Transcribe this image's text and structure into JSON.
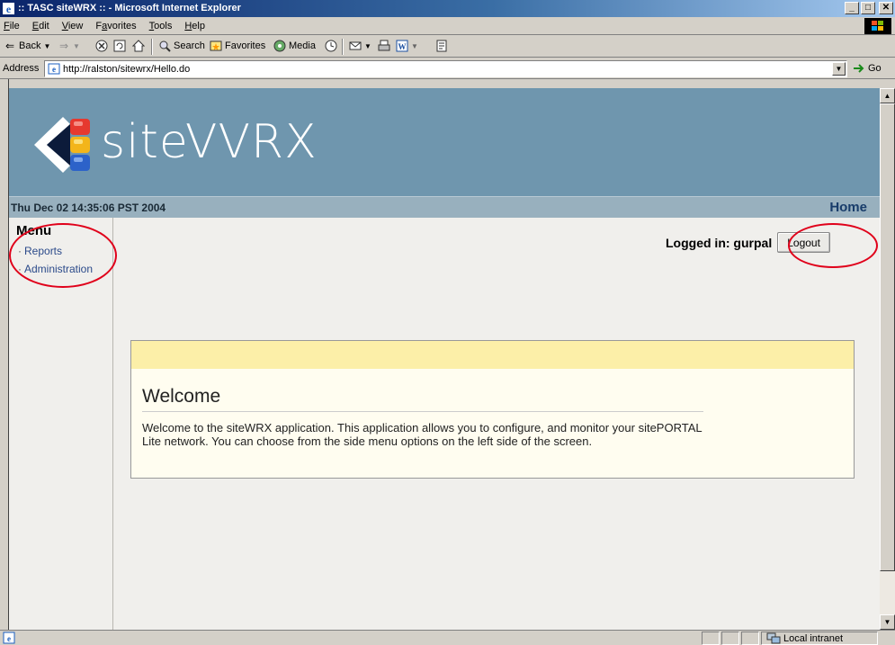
{
  "window": {
    "title": ":: TASC siteWRX :: - Microsoft Internet Explorer",
    "minimize": "_",
    "maximize": "□",
    "close": "✕"
  },
  "menubar": {
    "items": [
      {
        "prefix": "",
        "u": "F",
        "rest": "ile"
      },
      {
        "prefix": "",
        "u": "E",
        "rest": "dit"
      },
      {
        "prefix": "",
        "u": "V",
        "rest": "iew"
      },
      {
        "prefix": "F",
        "u": "a",
        "rest": "vorites"
      },
      {
        "prefix": "",
        "u": "T",
        "rest": "ools"
      },
      {
        "prefix": "",
        "u": "H",
        "rest": "elp"
      }
    ]
  },
  "toolbar": {
    "back": "Back",
    "search": "Search",
    "favorites": "Favorites",
    "media": "Media"
  },
  "address": {
    "label": "Address",
    "url": "http://ralston/sitewrx/Hello.do",
    "go": "Go"
  },
  "page": {
    "logo_text": "siteVVRX",
    "datetime": "Thu Dec 02 14:35:06 PST 2004",
    "home_link": "Home",
    "menu_title": "Menu",
    "menu_links": [
      "Reports",
      "Administration"
    ],
    "logged_in": "Logged in: gurpal",
    "logout": "Logout",
    "welcome_heading": "Welcome",
    "welcome_body": "Welcome to the siteWRX application. This application allows you to configure, and monitor your sitePORTAL Lite network. You can choose from the side menu options on the left side of the screen."
  },
  "statusbar": {
    "zone": "Local intranet"
  },
  "colors": {
    "banner": "#6f96ae",
    "datebar": "#98b0be",
    "welcome_strip": "#fcefa8",
    "annotation": "#e0001a"
  },
  "icons": [
    "ie-logo-icon",
    "back-icon",
    "forward-icon",
    "stop-icon",
    "refresh-icon",
    "home-icon",
    "search-icon",
    "favorites-icon",
    "media-icon",
    "history-icon",
    "mail-icon",
    "print-icon",
    "word-icon",
    "discuss-icon",
    "page-icon",
    "go-icon",
    "local-intranet-icon"
  ]
}
